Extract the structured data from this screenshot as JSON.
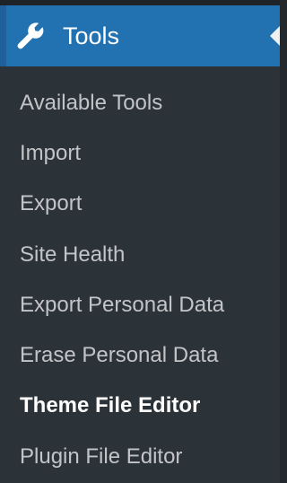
{
  "menu": {
    "title": "Tools",
    "icon": "wrench-icon",
    "colors": {
      "header_bg": "#2271b1",
      "submenu_bg": "#2c3338",
      "item_text": "#c3c4c7",
      "current_text": "#ffffff"
    },
    "items": [
      {
        "label": "Available Tools",
        "current": false
      },
      {
        "label": "Import",
        "current": false
      },
      {
        "label": "Export",
        "current": false
      },
      {
        "label": "Site Health",
        "current": false
      },
      {
        "label": "Export Personal Data",
        "current": false
      },
      {
        "label": "Erase Personal Data",
        "current": false
      },
      {
        "label": "Theme File Editor",
        "current": true
      },
      {
        "label": "Plugin File Editor",
        "current": false
      }
    ]
  }
}
